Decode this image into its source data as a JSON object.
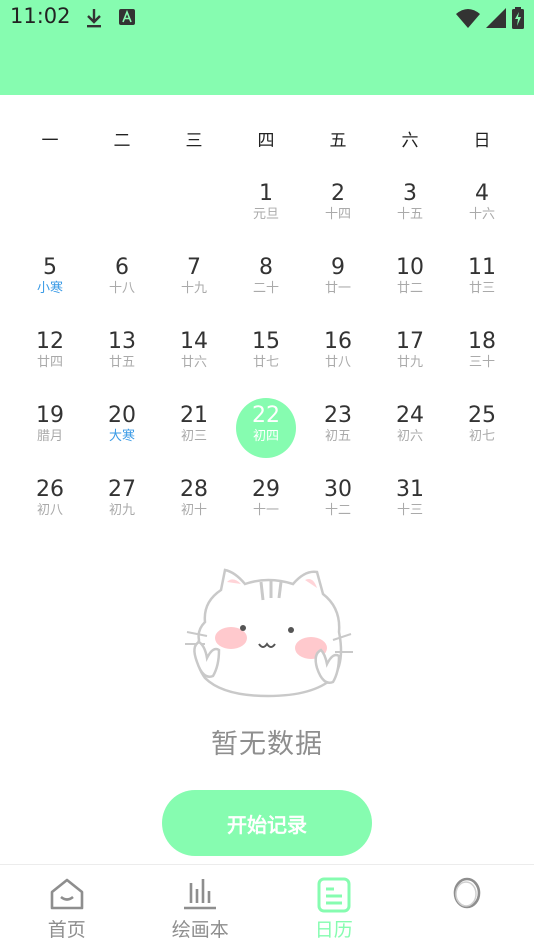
{
  "status": {
    "time": "11:02"
  },
  "calendar": {
    "weekdays": [
      "一",
      "二",
      "三",
      "四",
      "五",
      "六",
      "日"
    ],
    "days": [
      {
        "n": "",
        "s": ""
      },
      {
        "n": "",
        "s": ""
      },
      {
        "n": "",
        "s": ""
      },
      {
        "n": "1",
        "s": "元旦"
      },
      {
        "n": "2",
        "s": "十四"
      },
      {
        "n": "3",
        "s": "十五"
      },
      {
        "n": "4",
        "s": "十六"
      },
      {
        "n": "5",
        "s": "小寒",
        "term": true
      },
      {
        "n": "6",
        "s": "十八"
      },
      {
        "n": "7",
        "s": "十九"
      },
      {
        "n": "8",
        "s": "二十"
      },
      {
        "n": "9",
        "s": "廿一"
      },
      {
        "n": "10",
        "s": "廿二"
      },
      {
        "n": "11",
        "s": "廿三"
      },
      {
        "n": "12",
        "s": "廿四"
      },
      {
        "n": "13",
        "s": "廿五"
      },
      {
        "n": "14",
        "s": "廿六"
      },
      {
        "n": "15",
        "s": "廿七"
      },
      {
        "n": "16",
        "s": "廿八"
      },
      {
        "n": "17",
        "s": "廿九"
      },
      {
        "n": "18",
        "s": "三十"
      },
      {
        "n": "19",
        "s": "腊月"
      },
      {
        "n": "20",
        "s": "大寒",
        "term": true
      },
      {
        "n": "21",
        "s": "初三"
      },
      {
        "n": "22",
        "s": "初四",
        "selected": true
      },
      {
        "n": "23",
        "s": "初五"
      },
      {
        "n": "24",
        "s": "初六"
      },
      {
        "n": "25",
        "s": "初七"
      },
      {
        "n": "26",
        "s": "初八"
      },
      {
        "n": "27",
        "s": "初九"
      },
      {
        "n": "28",
        "s": "初十"
      },
      {
        "n": "29",
        "s": "十一"
      },
      {
        "n": "30",
        "s": "十二"
      },
      {
        "n": "31",
        "s": "十三"
      }
    ]
  },
  "empty_state": {
    "text": "暂无数据",
    "icon": "cat-illustration"
  },
  "start_button": {
    "label": "开始记录"
  },
  "nav": {
    "items": [
      {
        "label": "首页",
        "icon": "home-icon"
      },
      {
        "label": "绘画本",
        "icon": "bar-chart-icon"
      },
      {
        "label": "日历",
        "icon": "calendar-icon",
        "active": true
      },
      {
        "label": "",
        "icon": "profile-circle-icon"
      }
    ]
  },
  "colors": {
    "accent": "#86fcb0",
    "solar_term": "#3b9be6",
    "muted": "#aaaaaa"
  }
}
